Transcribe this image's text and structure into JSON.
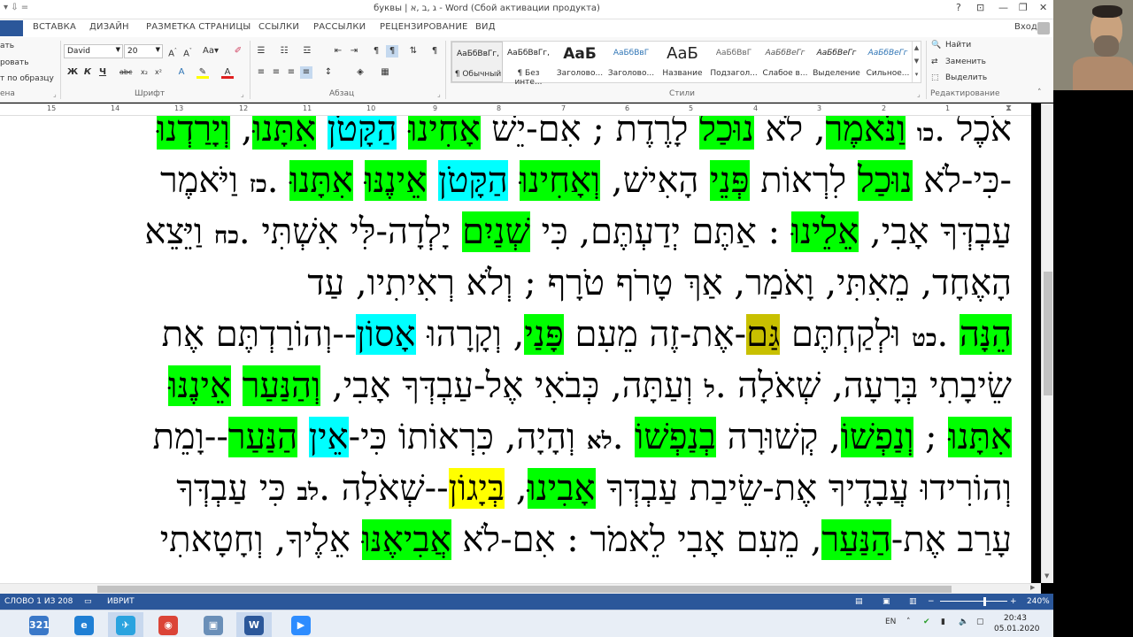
{
  "window": {
    "title": "буквы | ג ,ב ,א - Word (Сбой активации продукта)",
    "help": "?",
    "minimize": "—",
    "restore": "❐",
    "close": "✕",
    "signin": "Вход"
  },
  "ribbon_tabs": [
    "ВСТАВКА",
    "ДИЗАЙН",
    "РАЗМЕТКА СТРАНИЦЫ",
    "ССЫЛКИ",
    "РАССЫЛКИ",
    "РЕЦЕНЗИРОВАНИЕ",
    "ВИД"
  ],
  "clipboard": {
    "paste_partial": "ать",
    "cut_partial": "ровать",
    "format_painter": "т по образцу",
    "group_label": "ена"
  },
  "font": {
    "name": "David",
    "size": "20",
    "group_label": "Шрифт"
  },
  "paragraph": {
    "group_label": "Абзац"
  },
  "styles": {
    "group_label": "Стили",
    "items": [
      {
        "sample": "АаБбВвГг,",
        "name": "¶ Обычный"
      },
      {
        "sample": "АаБбВвГг,",
        "name": "¶ Без инте..."
      },
      {
        "sample": "АаБ",
        "name": "Заголово..."
      },
      {
        "sample": "АаБбВвГ",
        "name": "Заголово..."
      },
      {
        "sample": "АаБ",
        "name": "Название"
      },
      {
        "sample": "АаБбВвГ",
        "name": "Подзагол..."
      },
      {
        "sample": "АаБбВеГг",
        "name": "Слабое в..."
      },
      {
        "sample": "АаБбВеГг",
        "name": "Выделение"
      },
      {
        "sample": "АаБбВеГг",
        "name": "Сильное..."
      }
    ]
  },
  "editing": {
    "find": "Найти",
    "replace": "Заменить",
    "select": "Выделить",
    "group_label": "Редактирование"
  },
  "ruler_numbers": [
    "15",
    "14",
    "13",
    "12",
    "11",
    "10",
    "9",
    "8",
    "7",
    "6",
    "5",
    "4",
    "3",
    "2",
    "1"
  ],
  "document": {
    "lines": [
      [
        [
          "אֹכֶל  .",
          ""
        ],
        [
          "כו",
          "num"
        ],
        [
          " ",
          ""
        ],
        [
          "וַנֹּאמֶר",
          "g"
        ],
        [
          ", לֹא ",
          ""
        ],
        [
          "נוּכַל",
          "g"
        ],
        [
          " לָרֶדֶת ;  אִם-יֵשׁ ",
          ""
        ],
        [
          "אָחִינוּ",
          "g"
        ],
        [
          " ",
          ""
        ],
        [
          "הַקָּטֹן",
          "c"
        ],
        [
          " ",
          ""
        ],
        [
          "אִתָּנוּ",
          "g"
        ],
        [
          ", ",
          ""
        ],
        [
          "וְיָרַדְנוּ",
          "g"
        ]
      ],
      [
        [
          "-כִּי-לֹא ",
          ""
        ],
        [
          "נוּכַל",
          "g"
        ],
        [
          " לִרְאוֹת ",
          ""
        ],
        [
          "פְּנֵי",
          "g"
        ],
        [
          " הָאִישׁ, ",
          ""
        ],
        [
          "וְאָחִינוּ",
          "g"
        ],
        [
          " ",
          ""
        ],
        [
          "הַקָּטֹן",
          "c"
        ],
        [
          " ",
          ""
        ],
        [
          "אֵינֶנּוּ",
          "g"
        ],
        [
          " ",
          ""
        ],
        [
          "אִתָּנוּ",
          "g"
        ],
        [
          "  .",
          ""
        ],
        [
          "כז",
          "num"
        ],
        [
          " וַיֹּאמֶר",
          ""
        ]
      ],
      [
        [
          "עַבְדְּךָ אָבִי, ",
          ""
        ],
        [
          "אֵלֵינוּ",
          "g"
        ],
        [
          " :  אַתֶּם יְדַעְתֶּם, כִּי ",
          ""
        ],
        [
          "שְׁנַיִם",
          "g"
        ],
        [
          " יָלְדָה-לִּי אִשְׁתִּי  .",
          ""
        ],
        [
          "כח",
          "num"
        ],
        [
          " וַיֵּצֵא",
          ""
        ]
      ],
      [
        [
          "הָאֶחָד, מֵאִתִּי, וָאֹמַר, אַךְ טָרֹף טֹרָף ;  וְלֹא רְאִיתִיו, עַד",
          ""
        ]
      ],
      [
        [
          "הֵנָּה",
          "g"
        ],
        [
          "  .",
          ""
        ],
        [
          "כט",
          "num"
        ],
        [
          " וּלְקַחְתֶּם ",
          ""
        ],
        [
          "גַּם",
          "o"
        ],
        [
          "-אֶת-זֶה מֵעִם ",
          ""
        ],
        [
          "פָּנַי",
          "g"
        ],
        [
          ", וְקָרָהוּ ",
          ""
        ],
        [
          "אָסוֹן",
          "c"
        ],
        [
          "--וְהוֹרַדְתֶּם אֶת",
          ""
        ]
      ],
      [
        [
          "שֵׂיבָתִי בְּרָעָה, שְׁאֹלָה  .",
          ""
        ],
        [
          "ל",
          "num"
        ],
        [
          " וְעַתָּה, כְּבֹאִי אֶל-עַבְדְּךָ אָבִי, ",
          ""
        ],
        [
          "וְהַנַּעַר",
          "g"
        ],
        [
          " ",
          ""
        ],
        [
          "אֵינֶנּוּ",
          "g"
        ]
      ],
      [
        [
          "אִתָּנוּ",
          "g"
        ],
        [
          " ; ",
          ""
        ],
        [
          "וְנַפְשׁוֹ",
          "g"
        ],
        [
          ", קְשׁוּרָה ",
          ""
        ],
        [
          "בְנַפְשׁוֹ",
          "g"
        ],
        [
          "  .",
          ""
        ],
        [
          "לא",
          "num"
        ],
        [
          " וְהָיָה, כִּרְאוֹתוֹ כִּי-",
          ""
        ],
        [
          "אֵין",
          "c"
        ],
        [
          " ",
          ""
        ],
        [
          "הַנַּעַר",
          "g"
        ],
        [
          "--וָמֵת",
          ""
        ]
      ],
      [
        [
          "וְהוֹרִידוּ עֲבָדֶיךָ אֶת-שֵׂיבַת עַבְדְּךָ ",
          ""
        ],
        [
          "אָבִינוּ",
          "g"
        ],
        [
          ", ",
          ""
        ],
        [
          "בְּיָגוֹן",
          "y"
        ],
        [
          "--שְׁאֹלָה  .",
          ""
        ],
        [
          "לב",
          "num"
        ],
        [
          " כִּי עַבְדְּךָ",
          ""
        ]
      ],
      [
        [
          "עָרַב אֶת-",
          ""
        ],
        [
          "הַנַּעַר",
          "g"
        ],
        [
          ", מֵעִם אָבִי לֵאמֹר :  אִם-לֹא ",
          ""
        ],
        [
          "אֲבִיאֶנּוּ",
          "g"
        ],
        [
          " אֵלֶיךָ, וְחָטָאתִי",
          ""
        ]
      ]
    ]
  },
  "statusbar": {
    "page": "СЛОВО 1 ИЗ 208",
    "language": "ИВРИТ",
    "zoom": "240%"
  },
  "taskbar": {
    "lang": "EN",
    "time": "20:43",
    "date": "05.01.2020",
    "apps": [
      {
        "label": "321",
        "color": "#3a78c8"
      },
      {
        "label": "e",
        "color": "#1f7fd4"
      },
      {
        "label": "✈",
        "color": "#2aa3df"
      },
      {
        "label": "◉",
        "color": "#db4437"
      },
      {
        "label": "▣",
        "color": "#6a8fb8"
      },
      {
        "label": "W",
        "color": "#2b579a"
      },
      {
        "label": "▶",
        "color": "#2d8cff"
      }
    ]
  },
  "colors": {
    "green_highlight": "#00ff00",
    "cyan_highlight": "#00ffff",
    "yellow_highlight": "#ffff00",
    "olive_highlight": "#c8c000",
    "word_blue": "#2b579a"
  }
}
